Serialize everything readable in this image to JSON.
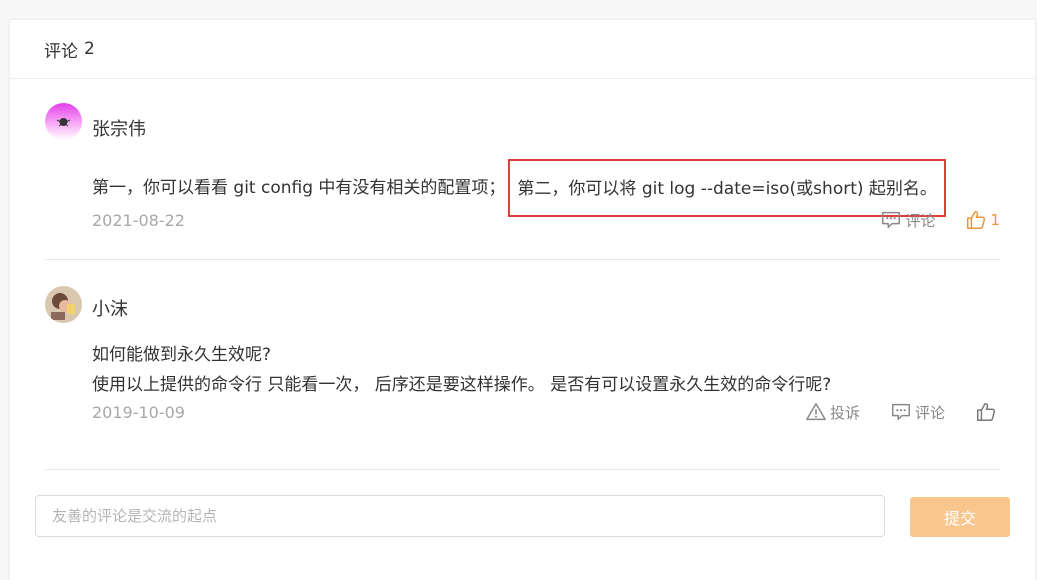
{
  "header": {
    "title": "评论",
    "count": "2"
  },
  "comments": [
    {
      "username": "张宗伟",
      "text_plain": "第一，你可以看看 git config 中有没有相关的配置项；",
      "text_highlight": "第二，你可以将 git log --date=iso(或short) 起别名。",
      "date": "2021-08-22",
      "comment_label": "评论",
      "like_count": "1"
    },
    {
      "username": "小沫",
      "line1": "如何能做到永久生效呢?",
      "line2": "使用以上提供的命令行 只能看一次， 后序还是要这样操作。 是否有可以设置永久生效的命令行呢?",
      "date": "2019-10-09",
      "report_label": "投诉",
      "comment_label": "评论"
    }
  ],
  "input": {
    "placeholder": "友善的评论是交流的起点"
  },
  "submit": {
    "label": "提交"
  },
  "colors": {
    "accent": "#e8963b",
    "highlight_border": "#e03c3c",
    "submit_bg": "#f9c78d"
  }
}
